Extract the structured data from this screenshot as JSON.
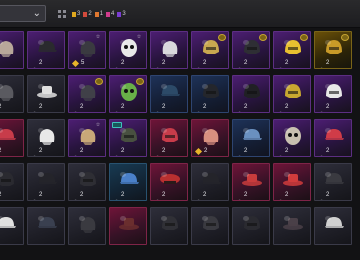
{
  "toolbar": {
    "dropdown": {
      "chevron_icon": "chevron-down-icon"
    },
    "grid_icon": "grid-view-icon",
    "rarity_filters": [
      {
        "label": "3",
        "color": "#e0a81e"
      },
      {
        "label": "2",
        "color": "#d24a3c"
      },
      {
        "label": "1",
        "color": "#e07830"
      },
      {
        "label": "4",
        "color": "#d23c8c"
      },
      {
        "label": "3",
        "color": "#7a3cd2"
      }
    ]
  },
  "inventory": {
    "items": [
      {
        "rarity": "epic",
        "icon": "headwear-icon",
        "color": "#b8a89a",
        "count": ""
      },
      {
        "rarity": "epic",
        "icon": "cap-icon",
        "color": "#2a2a2e",
        "count": "2"
      },
      {
        "rarity": "epic",
        "icon": "headwear-icon",
        "color": "#3a3a40",
        "count": "5",
        "currency": "diamond",
        "corner": "psk"
      },
      {
        "rarity": "epic",
        "icon": "panda-mask-icon",
        "color": "#e8e8e8",
        "count": "2",
        "corner": "psk"
      },
      {
        "rarity": "epic",
        "icon": "headwear-icon",
        "color": "#d8d8dc",
        "count": "2"
      },
      {
        "rarity": "epic",
        "icon": "helmet-icon",
        "color": "#c8a850",
        "count": "2",
        "corner": "round"
      },
      {
        "rarity": "epic",
        "icon": "helmet-icon",
        "color": "#2e2e34",
        "count": "2",
        "corner": "round"
      },
      {
        "rarity": "epic",
        "icon": "helmet-icon",
        "color": "#e8c030",
        "count": "2",
        "corner": "round"
      },
      {
        "rarity": "legend",
        "icon": "helmet-icon",
        "color": "#c89a28",
        "count": "2",
        "corner": "round"
      },
      {
        "rarity": "common",
        "icon": "headwear-icon",
        "color": "#5a5a60",
        "count": "2"
      },
      {
        "rarity": "common",
        "icon": "hat-icon",
        "color": "#e0e0e0",
        "count": "2"
      },
      {
        "rarity": "epic",
        "icon": "headwear-icon",
        "color": "#404048",
        "count": "2",
        "corner": "round"
      },
      {
        "rarity": "epic",
        "icon": "mask-icon",
        "color": "#68b048",
        "count": "2",
        "corner": "round"
      },
      {
        "rarity": "rare",
        "icon": "cap-icon",
        "color": "#2c4a68",
        "count": "2"
      },
      {
        "rarity": "rare",
        "icon": "helmet-icon",
        "color": "#24262c",
        "count": "2"
      },
      {
        "rarity": "epic",
        "icon": "helmet-icon",
        "color": "#202024",
        "count": "2"
      },
      {
        "rarity": "epic",
        "icon": "helmet-icon",
        "color": "#c8a830",
        "count": "2"
      },
      {
        "rarity": "epic",
        "icon": "helmet-icon",
        "color": "#e8e8e8",
        "count": "2"
      },
      {
        "rarity": "mythic",
        "icon": "cap-icon",
        "color": "#c83c4a",
        "count": "2",
        "ribbon": true
      },
      {
        "rarity": "common",
        "icon": "headwear-icon",
        "color": "#e8e8e8",
        "count": "2"
      },
      {
        "rarity": "epic",
        "icon": "headwear-icon",
        "color": "#c8a878",
        "count": "2",
        "corner": "psk"
      },
      {
        "rarity": "epic",
        "icon": "helmet-icon",
        "color": "#485040",
        "count": "2",
        "ribbon": true
      },
      {
        "rarity": "mythic",
        "icon": "helmet-icon",
        "color": "#c83c4a",
        "count": "2"
      },
      {
        "rarity": "mythic",
        "icon": "headwear-icon",
        "color": "#d89080",
        "count": "2",
        "currency": "diamond"
      },
      {
        "rarity": "rare",
        "icon": "cap-icon",
        "color": "#6a90c0",
        "count": "2"
      },
      {
        "rarity": "epic",
        "icon": "mask-icon",
        "color": "#c8c0b0",
        "count": "2"
      },
      {
        "rarity": "epic",
        "icon": "cap-icon",
        "color": "#d03c48",
        "count": "2"
      },
      {
        "rarity": "common",
        "icon": "helmet-icon",
        "color": "#2a2a30",
        "count": "2"
      },
      {
        "rarity": "common",
        "icon": "cap-icon",
        "color": "#24242a",
        "count": "2"
      },
      {
        "rarity": "common",
        "icon": "helmet-icon",
        "color": "#2e2e34",
        "count": "2"
      },
      {
        "rarity": "blue",
        "icon": "cap-icon",
        "color": "#4a80c8",
        "count": "2"
      },
      {
        "rarity": "mythic",
        "icon": "beret-icon",
        "color": "#b83030",
        "count": "2"
      },
      {
        "rarity": "common",
        "icon": "cap-icon",
        "color": "#24242a",
        "count": "2"
      },
      {
        "rarity": "mythic",
        "icon": "hat-icon",
        "color": "#c83c3c",
        "count": "2"
      },
      {
        "rarity": "mythic",
        "icon": "hat-icon",
        "color": "#d03c3c",
        "count": "2"
      },
      {
        "rarity": "common",
        "icon": "cap-icon",
        "color": "#3a3a40",
        "count": "2"
      },
      {
        "rarity": "common",
        "icon": "cap-icon",
        "color": "#e0e0e0",
        "count": ""
      },
      {
        "rarity": "common",
        "icon": "cap-icon",
        "color": "#3a4050",
        "count": ""
      },
      {
        "rarity": "common",
        "icon": "headwear-icon",
        "color": "#3a3a40",
        "count": ""
      },
      {
        "rarity": "mythic",
        "icon": "hat-icon",
        "color": "#6a2e2e",
        "count": ""
      },
      {
        "rarity": "common",
        "icon": "helmet-icon",
        "color": "#303036",
        "count": ""
      },
      {
        "rarity": "common",
        "icon": "helmet-icon",
        "color": "#3a3a40",
        "count": ""
      },
      {
        "rarity": "common",
        "icon": "helmet-icon",
        "color": "#2a2a30",
        "count": ""
      },
      {
        "rarity": "common",
        "icon": "hat-icon",
        "color": "#4a4048",
        "count": ""
      },
      {
        "rarity": "common",
        "icon": "cap-icon",
        "color": "#d0d0d0",
        "count": ""
      }
    ]
  }
}
